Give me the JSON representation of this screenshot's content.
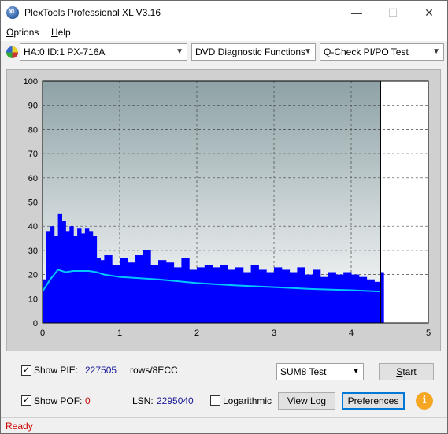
{
  "window": {
    "title": "PlexTools Professional XL V3.16",
    "icon_text": "XL",
    "minimize_glyph": "—",
    "maximize_glyph": "☐",
    "close_glyph": "✕"
  },
  "menu": {
    "items": [
      {
        "label": "Options",
        "accel": "O"
      },
      {
        "label": "Help",
        "accel": "H"
      }
    ]
  },
  "toolbar": {
    "drive": "HA:0 ID:1  PX-716A",
    "function": "DVD Diagnostic Functions",
    "test": "Q-Check PI/PO Test"
  },
  "chart_data": {
    "type": "area",
    "xlim": [
      0,
      5
    ],
    "ylim": [
      0,
      100
    ],
    "x_ticks": [
      "0",
      "1",
      "2",
      "3",
      "4",
      "5"
    ],
    "y_ticks": [
      "0",
      "10",
      "20",
      "30",
      "40",
      "50",
      "60",
      "70",
      "80",
      "90",
      "100"
    ],
    "grid": true,
    "end_marker_x": 4.38,
    "series": [
      {
        "kind": "bars",
        "color": "#0000ff",
        "x": [
          0.0,
          0.05,
          0.1,
          0.15,
          0.2,
          0.25,
          0.3,
          0.35,
          0.4,
          0.45,
          0.5,
          0.55,
          0.6,
          0.65,
          0.7,
          0.75,
          0.8,
          0.9,
          1.0,
          1.1,
          1.2,
          1.3,
          1.4,
          1.5,
          1.6,
          1.7,
          1.8,
          1.9,
          2.0,
          2.1,
          2.2,
          2.3,
          2.4,
          2.5,
          2.6,
          2.7,
          2.8,
          2.9,
          3.0,
          3.1,
          3.2,
          3.3,
          3.4,
          3.5,
          3.6,
          3.7,
          3.8,
          3.9,
          4.0,
          4.1,
          4.2,
          4.3,
          4.37
        ],
        "y": [
          18,
          38,
          40,
          36,
          45,
          42,
          38,
          40,
          36,
          39,
          37,
          39,
          38,
          36,
          27,
          26,
          28,
          24,
          27,
          25,
          28,
          30,
          24,
          26,
          25,
          23,
          27,
          22,
          23,
          24,
          23,
          24,
          22,
          23,
          21,
          24,
          22,
          21,
          23,
          22,
          21,
          23,
          20,
          22,
          19,
          21,
          20,
          21,
          20,
          19,
          18,
          17,
          21
        ]
      },
      {
        "kind": "line",
        "color": "#00c8ff",
        "x": [
          0.0,
          0.1,
          0.2,
          0.3,
          0.4,
          0.5,
          0.6,
          0.7,
          0.8,
          1.0,
          1.5,
          2.0,
          2.5,
          3.0,
          3.5,
          4.0,
          4.37
        ],
        "y": [
          13,
          18,
          22,
          21,
          21.5,
          21.5,
          21.5,
          21,
          20,
          19,
          18,
          16.5,
          15.5,
          14.8,
          14,
          13.5,
          13
        ]
      }
    ]
  },
  "controls": {
    "show_pie_label": "Show PIE:",
    "show_pie_checked": true,
    "pie_value": "227505",
    "pie_unit": "rows/8ECC",
    "show_pof_label": "Show POF:",
    "show_pof_checked": true,
    "pof_value": "0",
    "lsn_label": "LSN:",
    "lsn_value": "2295040",
    "logarithmic_label": "Logarithmic",
    "logarithmic_checked": false,
    "sum_test": "SUM8 Test",
    "start_label": "Start",
    "view_log_label": "View Log",
    "preferences_label": "Preferences",
    "info_glyph": "i"
  },
  "status": {
    "text": "Ready"
  }
}
